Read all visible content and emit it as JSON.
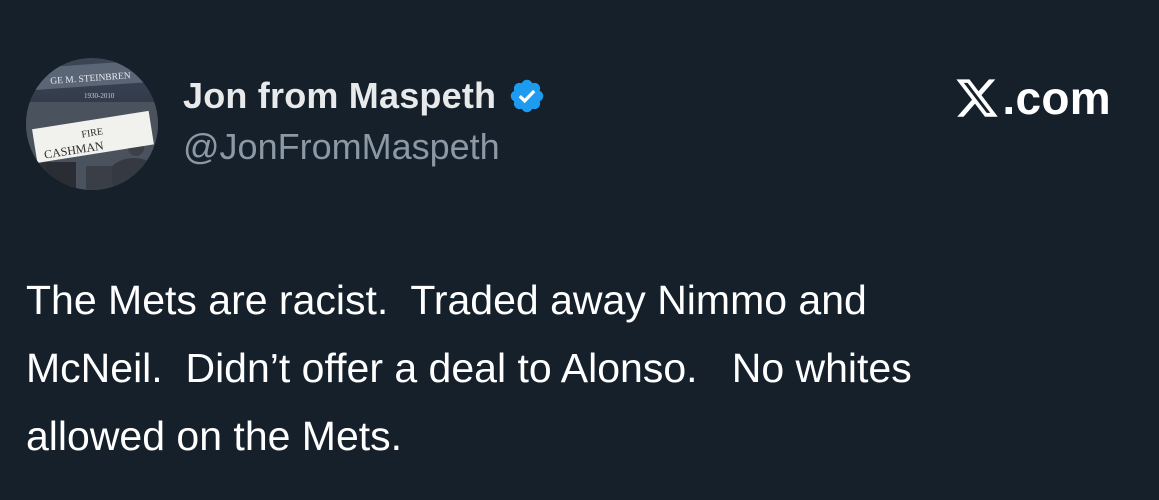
{
  "tweet": {
    "author": {
      "display_name": "Jon from Maspeth",
      "handle": "@JonFromMaspeth",
      "verified": true,
      "avatar": {
        "icon": "profile-photo",
        "text_top": "GE M. STEINBREN",
        "text_years": "1930-2010",
        "sign_line1": "FIRE",
        "sign_line2": "CASHMAN"
      }
    },
    "brand": {
      "icon": "x-logo-icon",
      "label": ".com"
    },
    "text_lines": [
      "The Mets are racist.  Traded away Nimmo and",
      "McNeil.  Didn’t offer a deal to Alonso.   No whites",
      "allowed on the Mets."
    ]
  },
  "colors": {
    "background": "#15202b",
    "text_primary": "#ffffff",
    "text_secondary": "#8b98a5",
    "verified_blue": "#1d9bf0"
  }
}
